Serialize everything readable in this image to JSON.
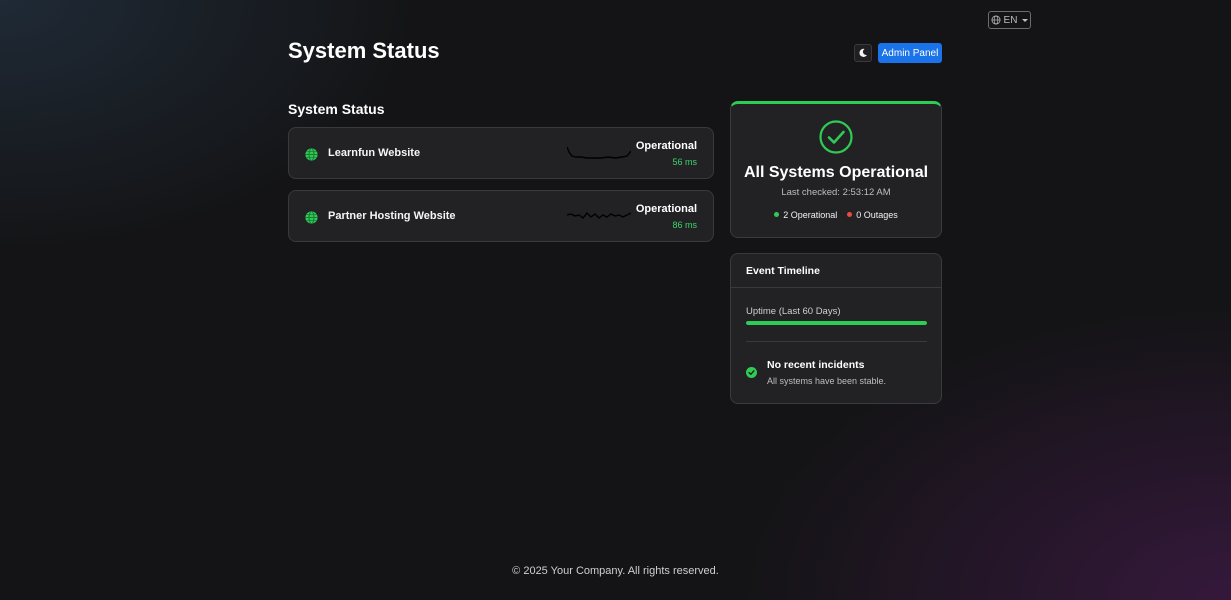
{
  "header": {
    "title": "System Status",
    "language": "EN",
    "admin_button": "Admin Panel"
  },
  "services_section": {
    "title": "System Status",
    "items": [
      {
        "name": "Learnfun Website",
        "status": "Operational",
        "latency": "56 ms",
        "icon": "globe-icon"
      },
      {
        "name": "Partner Hosting Website",
        "status": "Operational",
        "latency": "86 ms",
        "icon": "globe-icon"
      }
    ]
  },
  "summary": {
    "headline": "All Systems Operational",
    "last_checked": "Last checked: 2:53:12 AM",
    "operational_count": "2 Operational",
    "outages_count": "0 Outages",
    "icon": "check-circle-icon"
  },
  "timeline": {
    "title": "Event Timeline",
    "uptime_label": "Uptime (Last 60 Days)",
    "uptime_fraction": 1.0,
    "incident_title": "No recent incidents",
    "incident_subtitle": "All systems have been stable."
  },
  "footer": {
    "text": "© 2025 Your Company. All rights reserved."
  },
  "colors": {
    "accent_blue": "#1a73e8",
    "operational_green": "#2ecc55",
    "outage_red": "#e74c3c",
    "background": "#141416",
    "card": "#222225"
  }
}
